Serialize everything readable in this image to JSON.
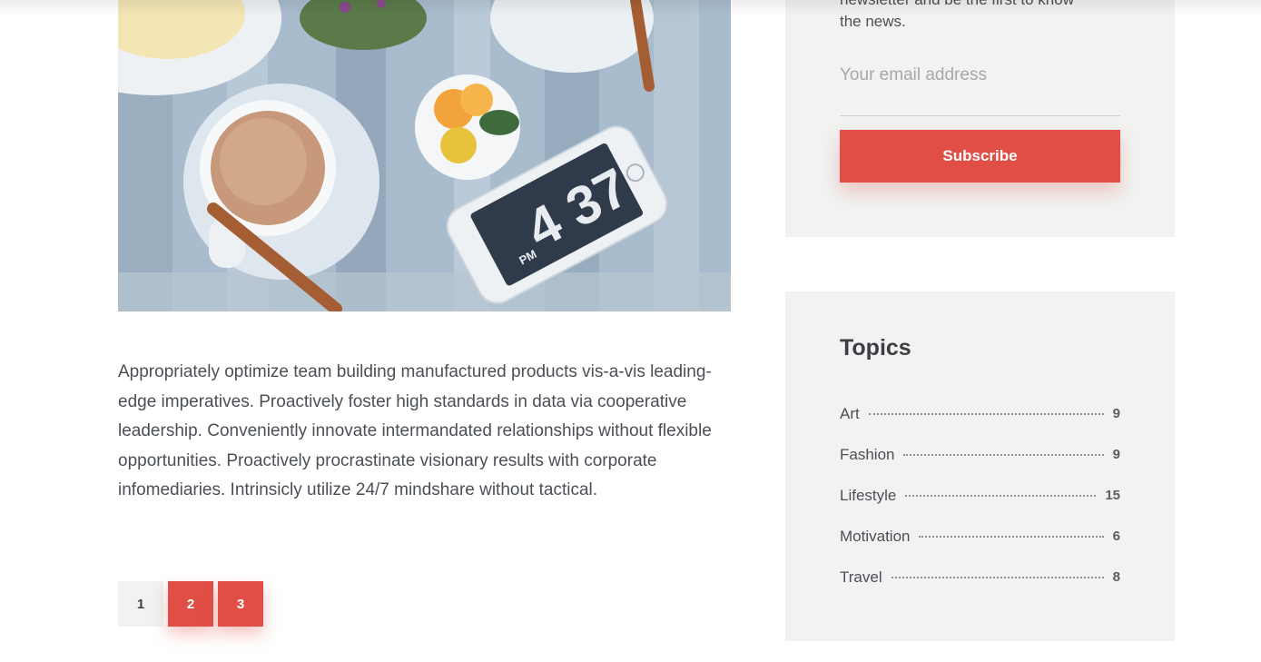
{
  "newsletter": {
    "partial_text_line1": "newsletter and be the first to know",
    "partial_text_line2": "the news.",
    "email_placeholder": "Your email address",
    "subscribe_label": "Subscribe"
  },
  "post": {
    "image_phone_time": "4 37",
    "image_phone_ampm": "PM",
    "body": "Appropriately optimize team building manufactured products vis-a-vis leading-edge imperatives. Proactively foster high standards in data via cooperative leadership. Conveniently innovate intermandated relationships without flexible opportunities. Proactively procrastinate visionary results with corporate infomediaries. Intrinsicly utilize 24/7 mindshare without tactical."
  },
  "pagination": {
    "pages": [
      "1",
      "2",
      "3"
    ]
  },
  "topics": {
    "title": "Topics",
    "items": [
      {
        "name": "Art",
        "count": "9"
      },
      {
        "name": "Fashion",
        "count": "9"
      },
      {
        "name": "Lifestyle",
        "count": "15"
      },
      {
        "name": "Motivation",
        "count": "6"
      },
      {
        "name": "Travel",
        "count": "8"
      }
    ]
  },
  "colors": {
    "accent": "#e04e45",
    "panel": "#f1f2f1",
    "text": "#4b4f56"
  }
}
